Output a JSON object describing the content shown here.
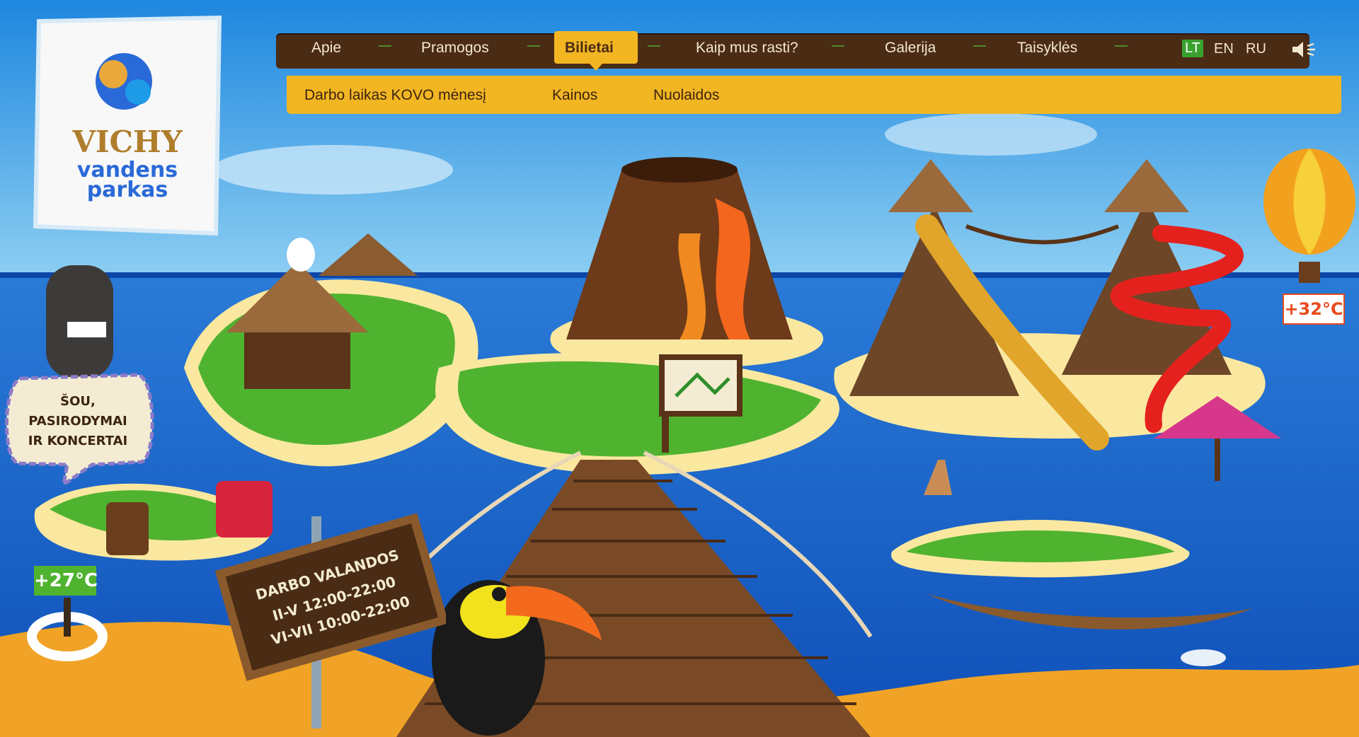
{
  "logo": {
    "line1": "VICHY",
    "line2": "vandens",
    "line3": "parkas"
  },
  "nav": {
    "items": [
      {
        "label": "Apie"
      },
      {
        "label": "Pramogos"
      },
      {
        "label": "Bilietai",
        "active": true
      },
      {
        "label": "Kaip mus rasti?"
      },
      {
        "label": "Galerija"
      },
      {
        "label": "Taisyklės"
      }
    ],
    "languages": [
      "LT",
      "EN",
      "RU"
    ],
    "active_language": "LT",
    "sound_icon": "speaker-icon"
  },
  "subnav": {
    "items": [
      {
        "label": "Darbo laikas KOVO mėnesį"
      },
      {
        "label": "Kainos"
      },
      {
        "label": "Nuolaidos"
      }
    ]
  },
  "show_bubble": {
    "line1": "ŠOU,",
    "line2": "PASIRODYMAI",
    "line3": "IR KONCERTAI"
  },
  "hours_sign": {
    "title": "DARBO VALANDOS",
    "line1": "II-V 12:00-22:00",
    "line2": "VI-VII 10:00-22:00"
  },
  "temperatures": {
    "water": "+27°C",
    "air": "+32°C"
  },
  "colors": {
    "nav_bg": "#4a2b14",
    "nav_accent": "#f2b623",
    "lang_active": "#3aa12f",
    "sea": "#1b5fc6",
    "sky": "#3fa3e6"
  }
}
